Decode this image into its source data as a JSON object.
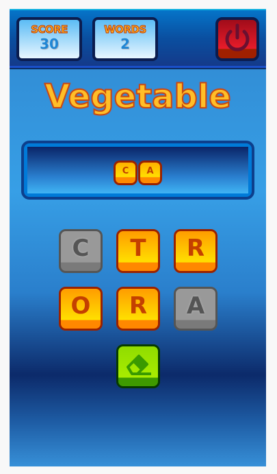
{
  "header": {
    "score": {
      "label": "SCORE",
      "value": "30"
    },
    "words": {
      "label": "WORDS",
      "value": "2"
    },
    "power_icon": "power-icon"
  },
  "category": "Vegetable",
  "answer_letters": [
    "C",
    "A"
  ],
  "tiles": [
    {
      "letter": "C",
      "used": true
    },
    {
      "letter": "T",
      "used": false
    },
    {
      "letter": "R",
      "used": false
    },
    {
      "letter": "O",
      "used": false
    },
    {
      "letter": "R",
      "used": false
    },
    {
      "letter": "A",
      "used": true
    }
  ],
  "eraser_icon": "eraser-icon",
  "colors": {
    "accent": "#ffbe28",
    "tile_border": "#9a2200",
    "eraser": "#a8ec00"
  }
}
